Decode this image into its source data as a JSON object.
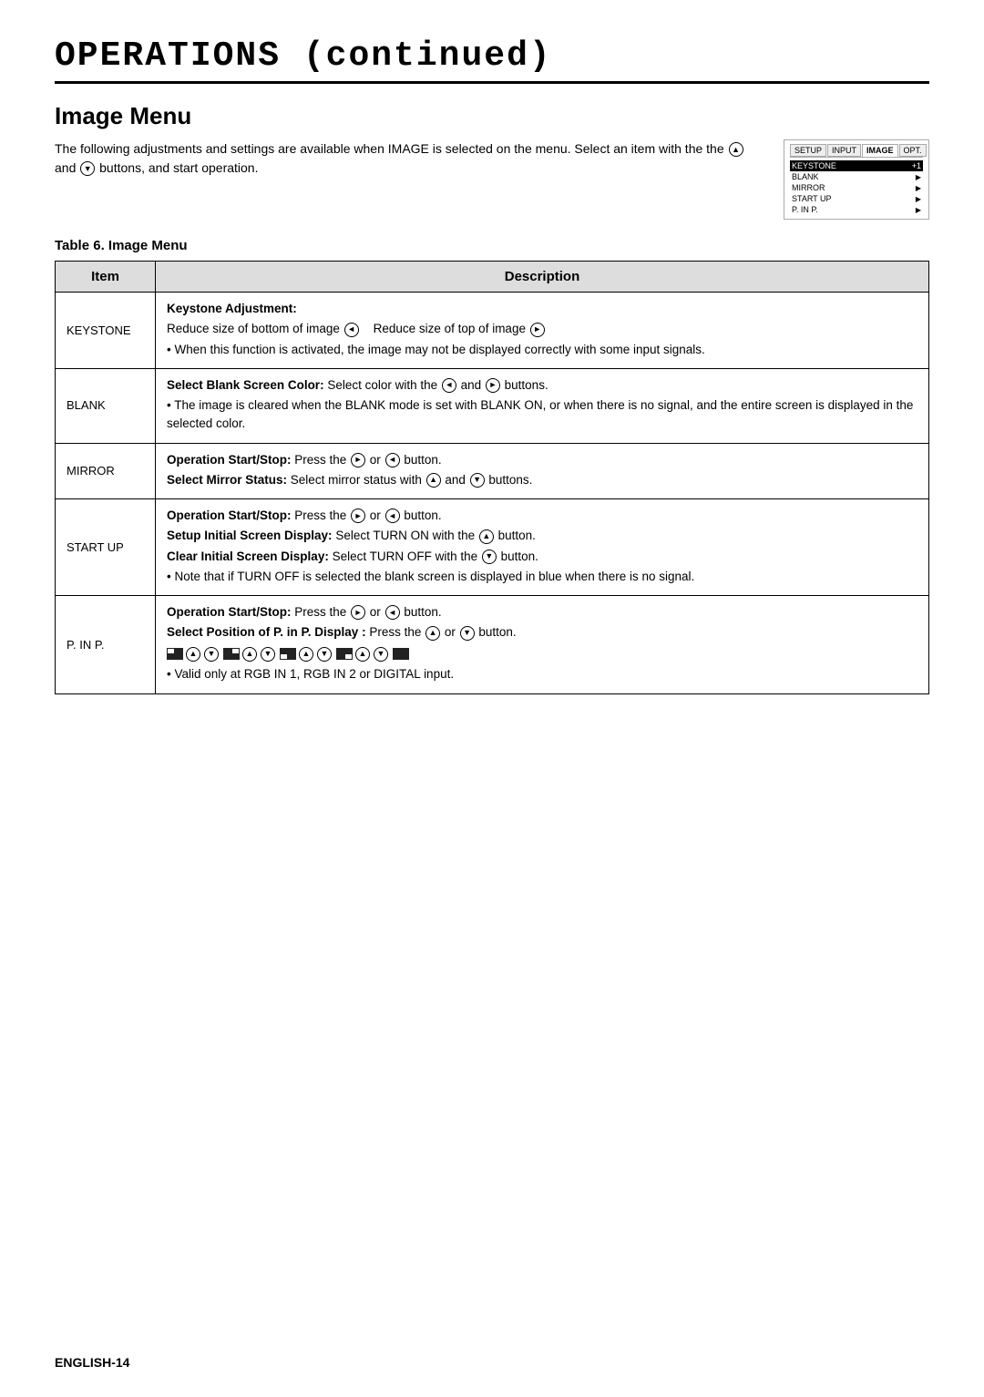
{
  "title": "OPERATIONS (continued)",
  "section": {
    "heading": "Image Menu",
    "intro_text": "The following adjustments and settings are available when IMAGE is selected on the menu. Select an item with the",
    "intro_middle": "and",
    "intro_end": "buttons, and start operation.",
    "table_heading": "Table 6. Image Menu"
  },
  "menu_ui": {
    "tabs": [
      "SETUP",
      "INPUT",
      "IMAGE",
      "OPT."
    ],
    "active_tab": "IMAGE",
    "items": [
      {
        "label": "KEYSTONE",
        "value": "+1",
        "selected": true
      },
      {
        "label": "BLANK",
        "arrow": true
      },
      {
        "label": "MIRROR",
        "arrow": true
      },
      {
        "label": "START UP",
        "arrow": true
      },
      {
        "label": "P. IN P.",
        "arrow": true
      }
    ]
  },
  "table": {
    "col_item": "Item",
    "col_desc": "Description",
    "rows": [
      {
        "item": "KEYSTONE",
        "desc_bold": "Keystone Adjustment:",
        "desc_lines": [
          "Reduce size of bottom of image ◄   Reduce size of top of image ►",
          "• When this function is activated, the image may not be displayed correctly with some input signals."
        ]
      },
      {
        "item": "BLANK",
        "desc_bold_inline": "Select Blank Screen Color:",
        "desc_bold_rest": " Select color with the ◄ and ► buttons.",
        "desc_lines": [
          "• The image is cleared when the BLANK mode is set with BLANK ON, or when there is no signal, and the entire screen is displayed in the selected color."
        ]
      },
      {
        "item": "MIRROR",
        "desc_bold_inline": "Operation Start/Stop:",
        "desc_bold_rest": " Press the ► or ◄ button.",
        "desc_bold_inline2": "Select Mirror Status:",
        "desc_bold_rest2": " Select mirror status with ▲ and ▼ buttons."
      },
      {
        "item": "START UP",
        "lines": [
          {
            "bold": "Operation Start/Stop:",
            "rest": " Press the ► or ◄ button."
          },
          {
            "bold": "Setup Initial Screen Display:",
            "rest": " Select TURN ON with the ▲ button."
          },
          {
            "bold": "Clear Initial Screen Display:",
            "rest": " Select TURN OFF with the ▼ button."
          },
          {
            "note": "• Note that if TURN OFF is selected the blank screen is displayed in blue when there is no signal."
          }
        ]
      },
      {
        "item": "P. IN P.",
        "lines": [
          {
            "bold": "Operation Start/Stop:",
            "rest": " Press the ► or ◄ button."
          },
          {
            "bold": "Select Position of P. in P. Display :",
            "rest": " Press the ▲ or ▼ button."
          },
          {
            "pip": true
          },
          {
            "note": "• Valid only at RGB IN 1, RGB IN 2 or DIGITAL input."
          }
        ]
      }
    ]
  },
  "footer": "ENGLISH-14"
}
